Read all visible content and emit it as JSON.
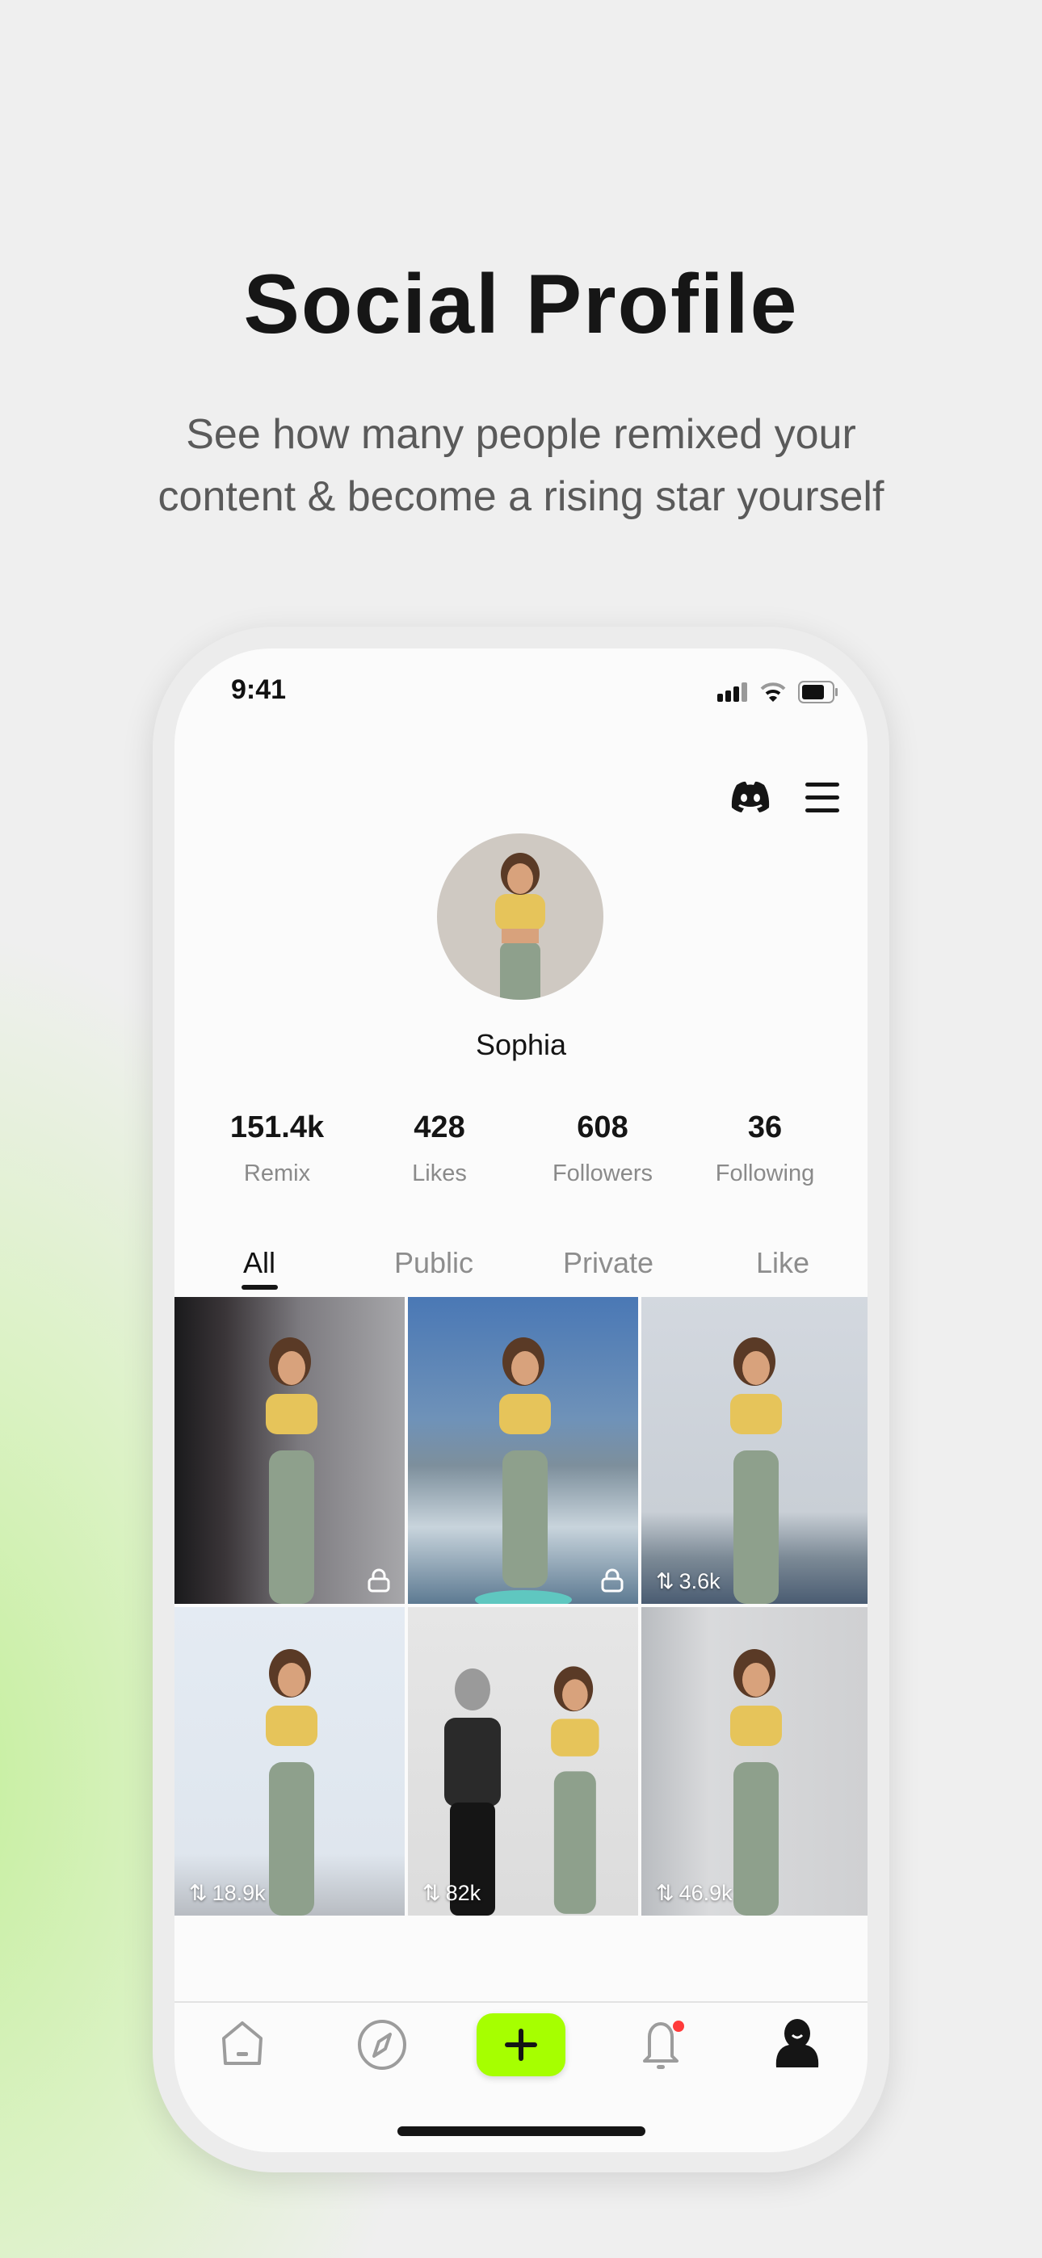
{
  "marketing": {
    "title": "Social Profile",
    "subtitle_line1": "See how many people remixed your",
    "subtitle_line2": "content & become a rising star yourself"
  },
  "status_bar": {
    "time": "9:41",
    "icons": [
      "signal-icon",
      "wifi-icon",
      "battery-icon"
    ]
  },
  "header": {
    "icons": [
      "discord-icon",
      "menu-icon"
    ]
  },
  "profile": {
    "name": "Sophia",
    "stats": [
      {
        "value": "151.4k",
        "label": "Remix"
      },
      {
        "value": "428",
        "label": "Likes"
      },
      {
        "value": "608",
        "label": "Followers"
      },
      {
        "value": "36",
        "label": "Following"
      }
    ]
  },
  "tabs": [
    {
      "label": "All",
      "active": true
    },
    {
      "label": "Public"
    },
    {
      "label": "Private"
    },
    {
      "label": "Like"
    }
  ],
  "posts": [
    {
      "locked": true,
      "remix": ""
    },
    {
      "locked": true,
      "remix": ""
    },
    {
      "locked": false,
      "remix": "3.6k"
    },
    {
      "locked": false,
      "remix": "18.9k"
    },
    {
      "locked": false,
      "remix": "82k"
    },
    {
      "locked": false,
      "remix": "46.9k"
    }
  ],
  "bottom_nav": {
    "items": [
      "home-icon",
      "explore-icon",
      "create-icon",
      "notifications-icon",
      "profile-icon"
    ],
    "active": "profile-icon",
    "accent": "#a6ff00",
    "notification_dot": "#ff3b3b"
  }
}
